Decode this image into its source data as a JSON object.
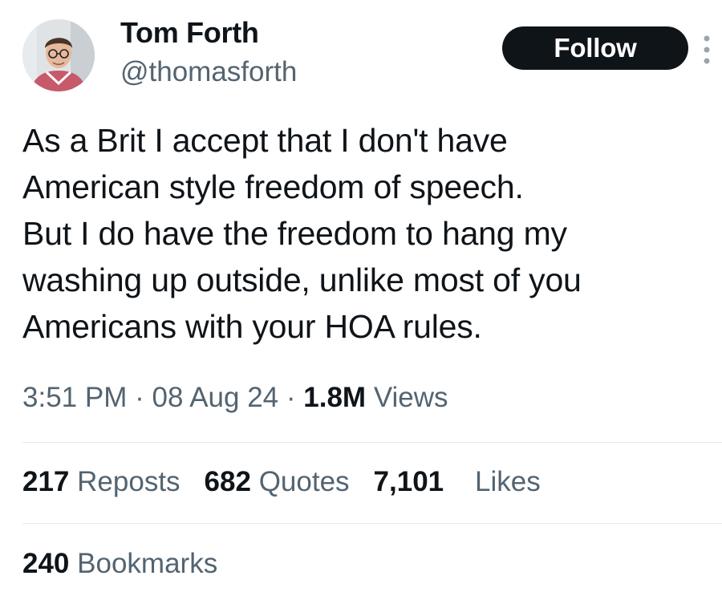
{
  "author": {
    "display_name": "Tom Forth",
    "handle": "@thomasforth",
    "avatar_icon": "profile-photo"
  },
  "follow_label": "Follow",
  "more_icon": "more-options-icon",
  "tweet": {
    "lines": [
      "As a Brit I accept that I don't have",
      "American style freedom of speech.",
      "But I do have the freedom to hang my",
      "washing up outside, unlike most of you",
      "Americans with your HOA rules."
    ]
  },
  "meta": {
    "time": "3:51 PM",
    "sep": "·",
    "date": "08 Aug 24",
    "views_count": "1.8M",
    "views_label": "Views"
  },
  "stats": {
    "reposts_count": "217",
    "reposts_label": "Reposts",
    "quotes_count": "682",
    "quotes_label": "Quotes",
    "likes_count": "7,101",
    "likes_label": "Likes",
    "bookmarks_count": "240",
    "bookmarks_label": "Bookmarks"
  },
  "colors": {
    "text_primary": "#0f1419",
    "text_secondary": "#536471",
    "button_bg": "#0f1419",
    "divider": "#e6e9eb"
  }
}
